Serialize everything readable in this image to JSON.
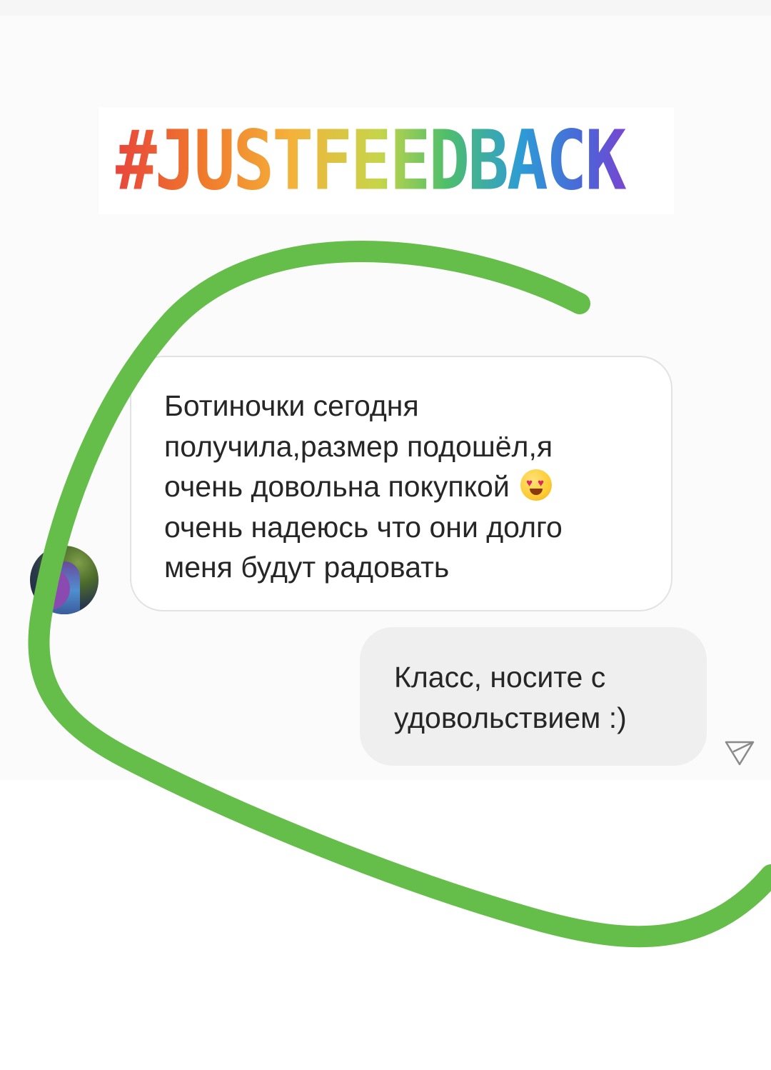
{
  "story": {
    "hashtag": "#JUSTFEEDBACK"
  },
  "chat": {
    "incoming": {
      "lines": [
        "Ботиночки сегодня",
        "получила,размер подошёл,я",
        "очень довольна покупкой",
        "очень надеюсь что они долго",
        "меня будут радовать"
      ],
      "emoji": "smiling-face-with-heart-eyes"
    },
    "outgoing": {
      "lines": [
        "Класс, носите с",
        "удовольствием :)"
      ]
    }
  },
  "colors": {
    "highlight_stroke": "#65bd4a",
    "incoming_bubble_border": "#e2e2e2",
    "outgoing_bubble_bg": "#efefef",
    "text": "#262626"
  }
}
